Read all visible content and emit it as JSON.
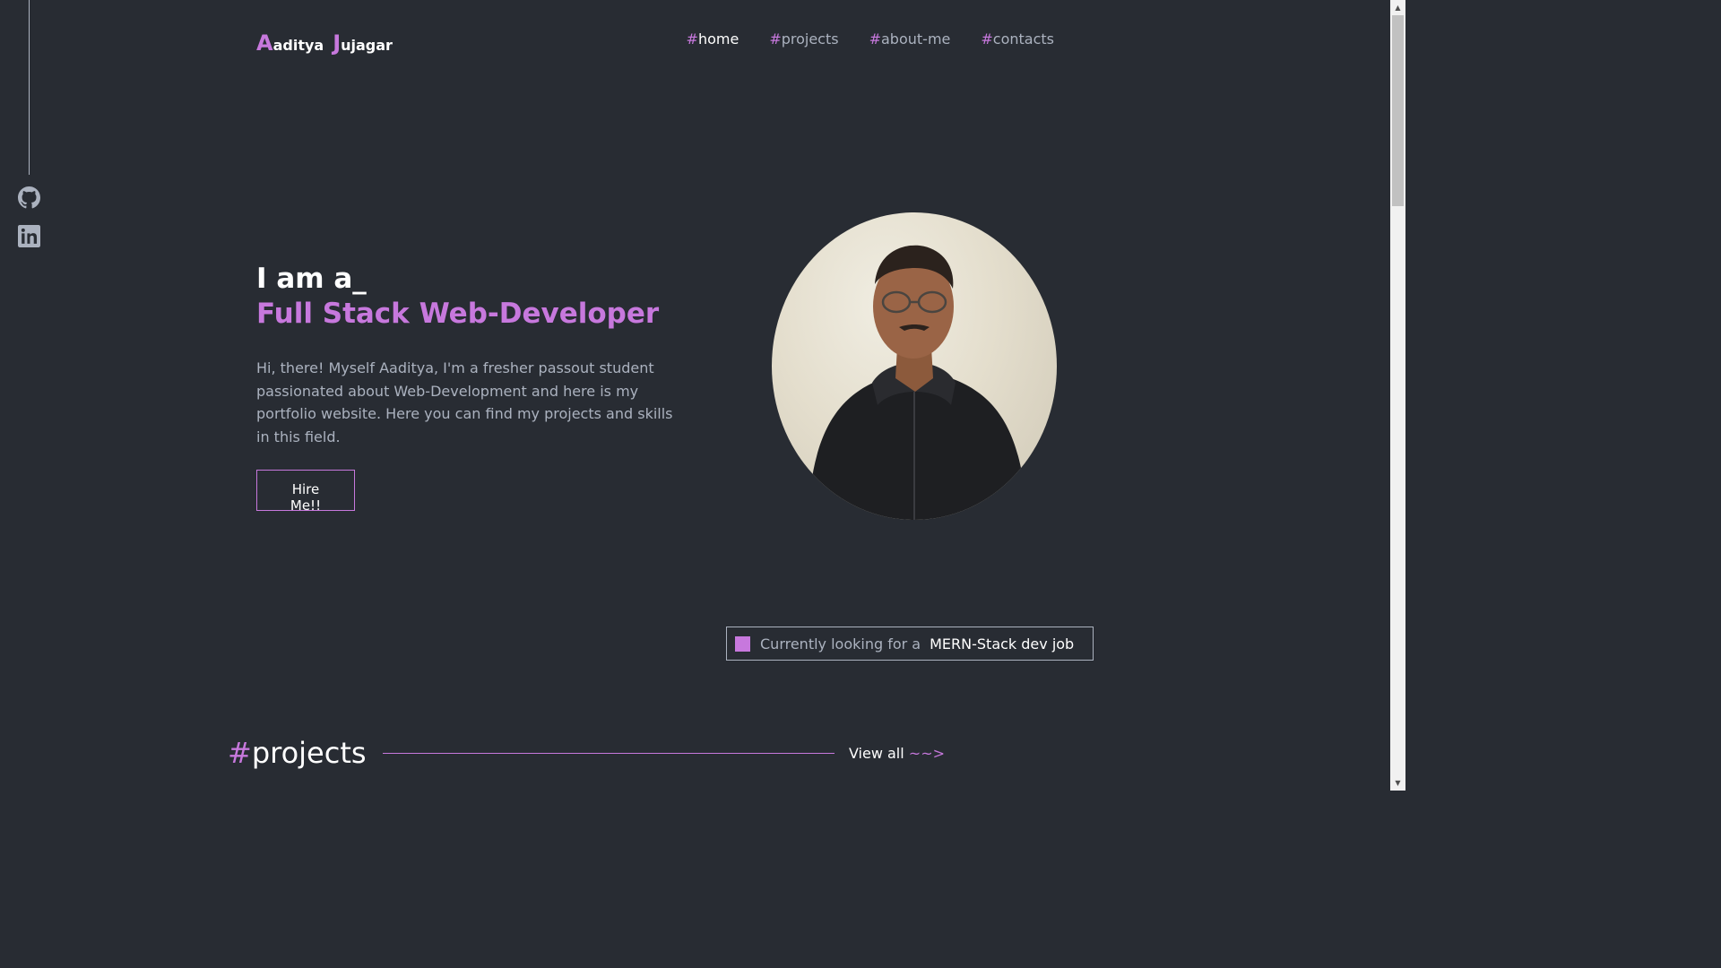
{
  "logo": {
    "first_initial": "A",
    "first_rest": "aditya",
    "last_initial": "J",
    "last_rest": "ujagar"
  },
  "nav": [
    {
      "hash": "#",
      "label": "home"
    },
    {
      "hash": "#",
      "label": "projects"
    },
    {
      "hash": "#",
      "label": "about-me"
    },
    {
      "hash": "#",
      "label": "contacts"
    }
  ],
  "hero": {
    "title": "I am a_",
    "subtitle": "Full Stack Web-Developer",
    "description": "Hi, there! Myself Aaditya, I'm a fresher passout student passionated about Web-Development and here is my portfolio website. Here you can find my projects and skills in this field.",
    "cta": "Hire Me!!"
  },
  "status": {
    "prefix": "Currently looking for a",
    "highlight": "MERN-Stack dev job"
  },
  "projects_section": {
    "hash": "#",
    "title": "projects",
    "view_all": "View all",
    "view_all_arrow": "~~>"
  },
  "social": [
    "github-icon",
    "linkedin-icon"
  ],
  "colors": {
    "background": "#282c33",
    "accent": "#c778dd",
    "text": "#abb2bf",
    "white": "#ffffff"
  }
}
